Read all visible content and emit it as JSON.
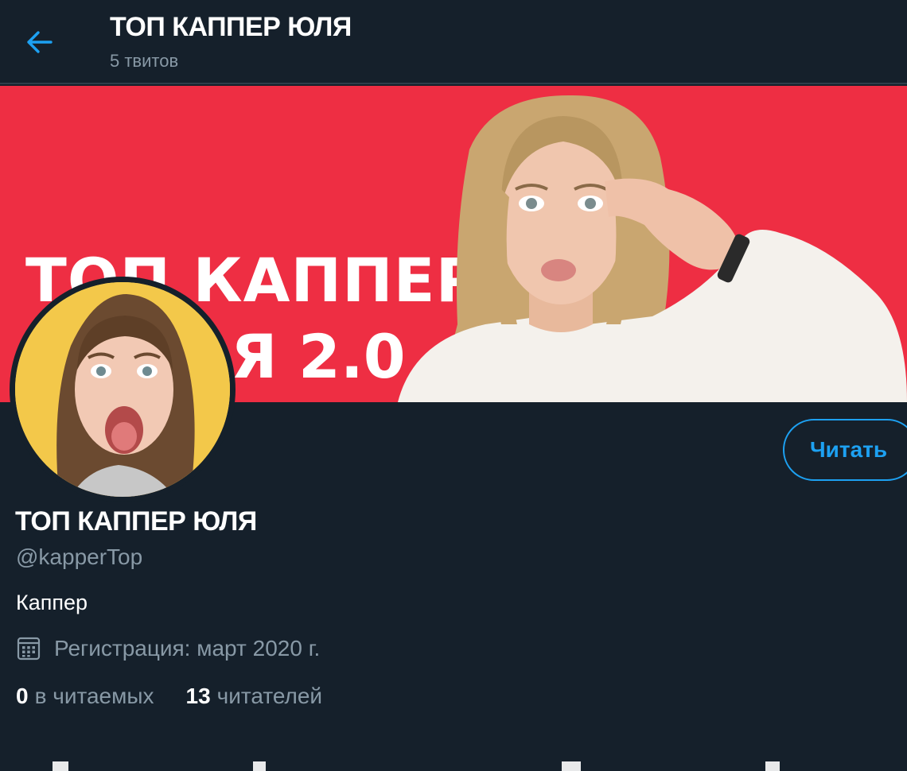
{
  "header": {
    "title": "ТОП КАППЕР ЮЛЯ",
    "tweet_count": "5 твитов",
    "back_icon": "arrow-left-icon"
  },
  "banner": {
    "line1": "ТОП КАППЕР",
    "line2": "Я 2.0",
    "background_color": "#ee2e43"
  },
  "profile": {
    "name": "ТОП КАППЕР ЮЛЯ",
    "handle": "@kapperTop",
    "bio": "Каппер",
    "joined": "Регистрация: март 2020 г.",
    "follow_label": "Читать"
  },
  "stats": {
    "following_count": "0",
    "following_label": "в читаемых",
    "followers_count": "13",
    "followers_label": "читателей"
  },
  "colors": {
    "background": "#15202b",
    "accent": "#1da1f2",
    "secondary_text": "#8899a6"
  }
}
